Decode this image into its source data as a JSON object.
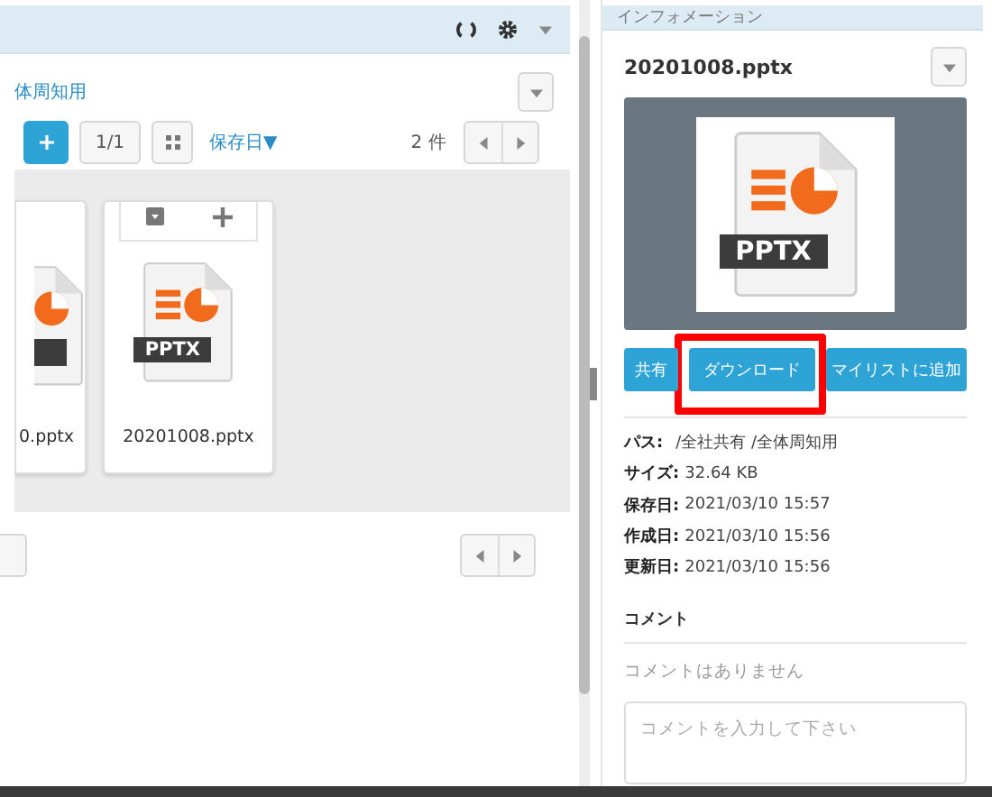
{
  "left_panel": {
    "breadcrumb": "体周知用",
    "toolbar": {
      "page": "1/1",
      "sort": "保存日▼",
      "count": "2 件"
    },
    "files": [
      {
        "name": "0.pptx",
        "clipped": true
      },
      {
        "name": "20201008.pptx",
        "type": "PPTX",
        "clipped": false
      }
    ]
  },
  "info_panel": {
    "title": "インフォメーション",
    "file_name": "20201008.pptx",
    "preview_type": "PPTX",
    "actions": [
      {
        "label": "共有",
        "highlighted": false
      },
      {
        "label": "ダウンロード",
        "highlighted": true
      },
      {
        "label": "マイリストに追加",
        "highlighted": false
      }
    ],
    "details": [
      {
        "label": "パス:",
        "value": "/全社共有 /全体周知用"
      },
      {
        "label": "サイズ:",
        "value": "32.64 KB"
      },
      {
        "label": "保存日:",
        "value": "2021/03/10 15:57"
      },
      {
        "label": "作成日:",
        "value": "2021/03/10 15:56"
      },
      {
        "label": "更新日:",
        "value": "2021/03/10 15:56"
      }
    ],
    "comments": {
      "heading": "コメント",
      "empty_text": "コメントはありません",
      "placeholder": "コメントを入力して下さい"
    }
  }
}
